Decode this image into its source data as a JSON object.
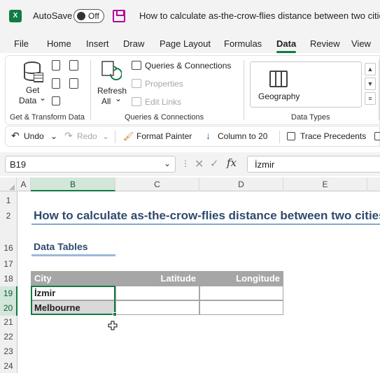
{
  "titlebar": {
    "app_icon": "excel-logo",
    "autosave_label": "AutoSave",
    "autosave_state": "Off",
    "doc_title": "How to calculate as-the-crow-flies distance between two cities in Excel"
  },
  "menu": {
    "tabs": [
      "File",
      "Home",
      "Insert",
      "Draw",
      "Page Layout",
      "Formulas",
      "Data",
      "Review",
      "View"
    ],
    "active": "Data"
  },
  "ribbon": {
    "get_data_line1": "Get",
    "get_data_line2": "Data",
    "get_data_arrow": "⌄",
    "group_get_transform": "Get & Transform Data",
    "refresh_line1": "Refresh",
    "refresh_line2": "All",
    "refresh_arrow": "⌄",
    "queries_connections": "Queries & Connections",
    "properties": "Properties",
    "edit_links": "Edit Links",
    "group_queries": "Queries & Connections",
    "geography": "Geography",
    "group_data_types": "Data Types"
  },
  "quick_toolbar": {
    "undo": "Undo",
    "redo": "Redo",
    "format_painter": "Format Painter",
    "column_to": "Column to 20",
    "trace_precedents": "Trace Precedents"
  },
  "formula_bar": {
    "name_box": "B19",
    "fx": "fx",
    "value": "İzmir"
  },
  "grid": {
    "columns": [
      "A",
      "B",
      "C",
      "D",
      "E"
    ],
    "rows": [
      "1",
      "2",
      "16",
      "17",
      "18",
      "19",
      "20",
      "21",
      "22",
      "23",
      "24"
    ],
    "selected_column": "B",
    "selected_rows": [
      "19",
      "20"
    ]
  },
  "sheet": {
    "title": "How to calculate as-the-crow-flies distance between two cities in Excel",
    "subtitle": "Data Tables",
    "table": {
      "headers": [
        "City",
        "Latitude",
        "Longitude"
      ],
      "rows": [
        [
          "İzmir",
          "",
          ""
        ],
        [
          "Melbourne",
          "",
          ""
        ]
      ]
    }
  },
  "colors": {
    "excel_green": "#107c41",
    "title_blue": "#2f4a6e",
    "header_gray": "#a6a6a6"
  }
}
